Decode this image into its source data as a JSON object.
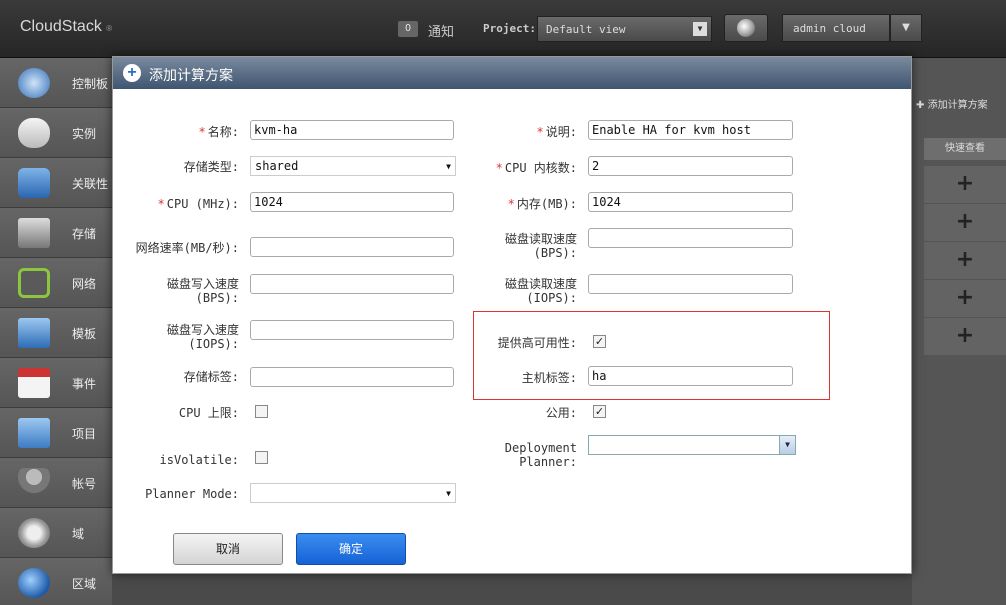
{
  "topbar": {
    "logo": "CloudStack",
    "logo_mark": "®",
    "notifications_count": "0",
    "notifications_label": "通知",
    "project_label": "Project:",
    "project_value": "Default view",
    "user_label": "admin cloud"
  },
  "sidebar": {
    "items": [
      {
        "label": "控制板",
        "icon": "dashboard-icon"
      },
      {
        "label": "实例",
        "icon": "cloud-icon"
      },
      {
        "label": "关联性",
        "icon": "affinity-icon"
      },
      {
        "label": "存储",
        "icon": "storage-icon"
      },
      {
        "label": "网络",
        "icon": "network-icon"
      },
      {
        "label": "模板",
        "icon": "template-icon"
      },
      {
        "label": "事件",
        "icon": "calendar-icon"
      },
      {
        "label": "项目",
        "icon": "folder-icon"
      },
      {
        "label": "帐号",
        "icon": "user-icon"
      },
      {
        "label": "域",
        "icon": "domain-icon"
      },
      {
        "label": "区域",
        "icon": "globe-icon"
      }
    ]
  },
  "background": {
    "add_offering": "添加计算方案",
    "quick_view_header": "快速查看",
    "quick_view_symbol": "+"
  },
  "dialog": {
    "title": "添加计算方案",
    "required_mark": "*",
    "fields": {
      "name_label": "名称:",
      "name_value": "kvm-ha",
      "description_label": "说明:",
      "description_value": "Enable HA for kvm host",
      "storage_type_label": "存储类型:",
      "storage_type_value": "shared",
      "cpu_cores_label": "CPU 内核数:",
      "cpu_cores_value": "2",
      "cpu_mhz_label": "CPU (MHz):",
      "cpu_mhz_value": "1024",
      "memory_label": "内存(MB):",
      "memory_value": "1024",
      "network_rate_label": "网络速率(MB/秒):",
      "network_rate_value": "",
      "disk_read_bps_label_1": "磁盘读取速度",
      "disk_read_bps_label_2": "(BPS):",
      "disk_read_bps_value": "",
      "disk_write_bps_label_1": "磁盘写入速度",
      "disk_write_bps_label_2": "(BPS):",
      "disk_write_bps_value": "",
      "disk_read_iops_label_1": "磁盘读取速度",
      "disk_read_iops_label_2": "(IOPS):",
      "disk_read_iops_value": "",
      "disk_write_iops_label_1": "磁盘写入速度",
      "disk_write_iops_label_2": "(IOPS):",
      "disk_write_iops_value": "",
      "offer_ha_label": "提供高可用性:",
      "offer_ha_checked": true,
      "storage_tags_label": "存储标签:",
      "storage_tags_value": "",
      "host_tags_label": "主机标签:",
      "host_tags_value": "ha",
      "cpu_cap_label": "CPU 上限:",
      "cpu_cap_checked": false,
      "public_label": "公用:",
      "public_checked": true,
      "is_volatile_label": "isVolatile:",
      "is_volatile_checked": false,
      "deployment_planner_label_1": "Deployment",
      "deployment_planner_label_2": "Planner:",
      "deployment_planner_value": "",
      "planner_mode_label": "Planner Mode:",
      "planner_mode_value": ""
    },
    "cancel_label": "取消",
    "ok_label": "确定"
  },
  "colors": {
    "dialog_header": "#3f5570",
    "required": "#d33333",
    "ok_button": "#1662d6",
    "highlight_box": "#d33333"
  }
}
